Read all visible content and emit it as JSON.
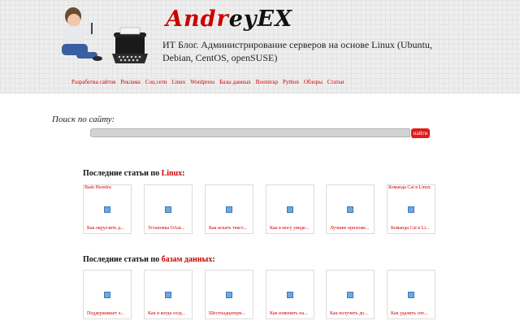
{
  "header": {
    "title_red": "Andr",
    "title_black": "eyEX",
    "tagline": "ИТ Блог. Администрирование серверов на основе Linux (Ubuntu, Debian, CentOS, openSUSE)",
    "nav": [
      "Разработка сайтов",
      "Реклама",
      "Соц сети",
      "Linux",
      "Wordpress",
      "Базы данных",
      "Bootstrap",
      "Python",
      "Обзоры",
      "Статьи"
    ]
  },
  "search": {
    "label": "Поиск по сайту:",
    "value": "",
    "button": "найти"
  },
  "section_linux": {
    "prefix": "Последние статьи по ",
    "highlight": "Linux",
    "suffix": ":",
    "cards": [
      {
        "top": "Bash Heredoc",
        "caption": "Как округлить д..."
      },
      {
        "top": "",
        "caption": "Установка OAut..."
      },
      {
        "top": "",
        "caption": "Как искать текст..."
      },
      {
        "top": "",
        "caption": "Как я могу увиде..."
      },
      {
        "top": "",
        "caption": "Лучшие приложе..."
      },
      {
        "top": "Команда Cal в Linux",
        "caption": "Команда Cal в Li..."
      }
    ]
  },
  "section_db": {
    "prefix": "Последние статьи по ",
    "highlight": "базам данных",
    "suffix": ":",
    "cards": [
      {
        "top": "",
        "caption": "Поддерживает л..."
      },
      {
        "top": "",
        "caption": "Как и когда созд..."
      },
      {
        "top": "",
        "caption": "Шестнадцатери..."
      },
      {
        "top": "",
        "caption": "Как изменить на..."
      },
      {
        "top": "",
        "caption": "Как получить до..."
      },
      {
        "top": "",
        "caption": "Как удалить спе..."
      }
    ]
  }
}
